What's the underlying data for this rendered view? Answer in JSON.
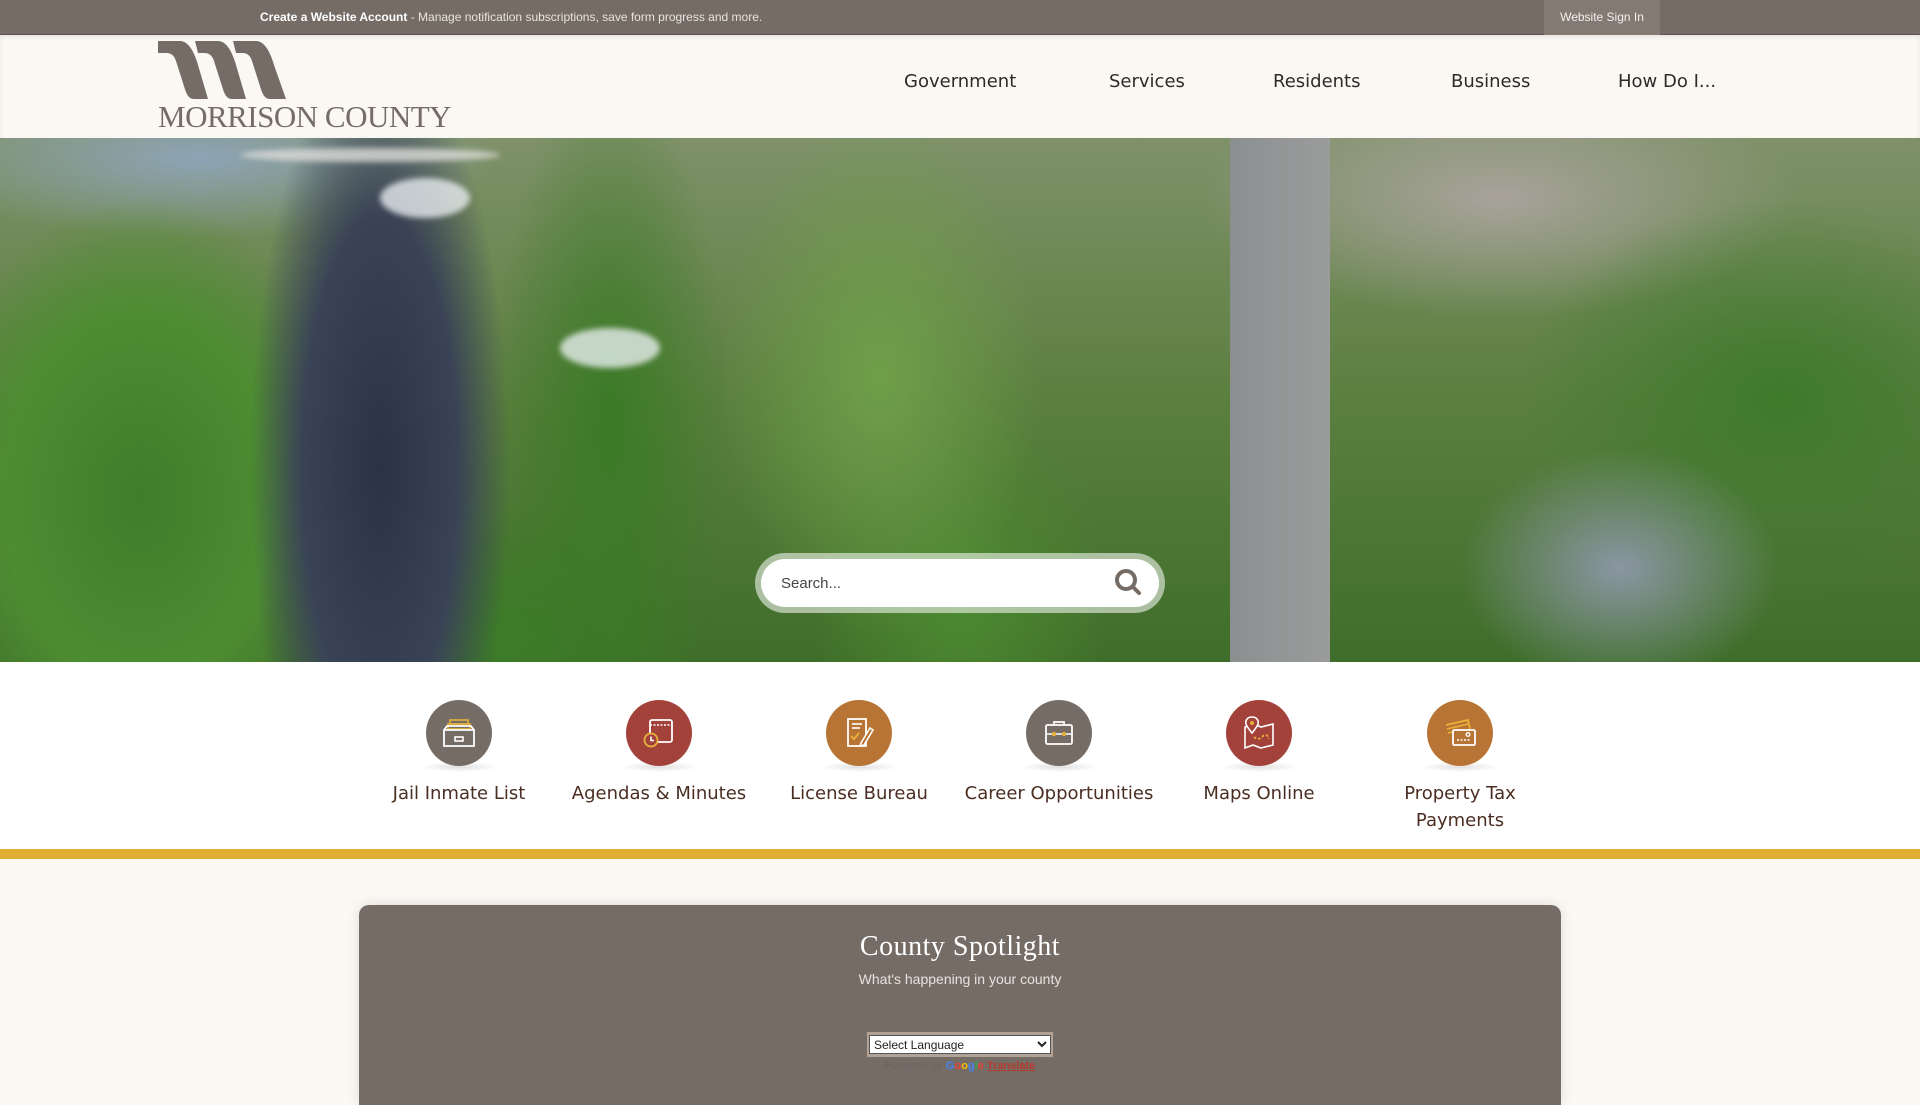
{
  "topbar": {
    "account_link": "Create a Website Account",
    "account_desc": " - Manage notification subscriptions, save form progress and more.",
    "sign_in": "Website Sign In"
  },
  "header": {
    "logo_text": "MORRISON COUNTY",
    "nav": [
      {
        "label": "Government"
      },
      {
        "label": "Services"
      },
      {
        "label": "Residents"
      },
      {
        "label": "Business"
      },
      {
        "label": "How Do I..."
      }
    ]
  },
  "hero": {
    "search_placeholder": "Search...",
    "search_icon": "search-icon"
  },
  "quick_links": [
    {
      "label": "Jail Inmate List",
      "icon": "file-drawer-icon",
      "color": "#756c66"
    },
    {
      "label": "Agendas & Minutes",
      "icon": "calendar-clock-icon",
      "color": "#a3423a"
    },
    {
      "label": "License Bureau",
      "icon": "document-pen-icon",
      "color": "#b87434"
    },
    {
      "label": "Career Opportunities",
      "icon": "briefcase-icon",
      "color": "#756c66"
    },
    {
      "label": "Maps Online",
      "icon": "map-pin-icon",
      "color": "#a3423a"
    },
    {
      "label": "Property Tax Payments",
      "icon": "credit-card-icon",
      "color": "#b87434"
    }
  ],
  "spotlight": {
    "title": "County Spotlight",
    "subtitle": "What's happening in your county",
    "language_select": "Select Language",
    "powered_by": "Powered by",
    "google": "Google",
    "translate": "Translate"
  },
  "colors": {
    "topbar": "#756c66",
    "header_bg": "#fbf8f4",
    "gold": "#e0ad33",
    "brown_gray": "#756c66",
    "red": "#a3423a",
    "orange": "#b87434",
    "accent_yellow": "#e8b23a"
  }
}
